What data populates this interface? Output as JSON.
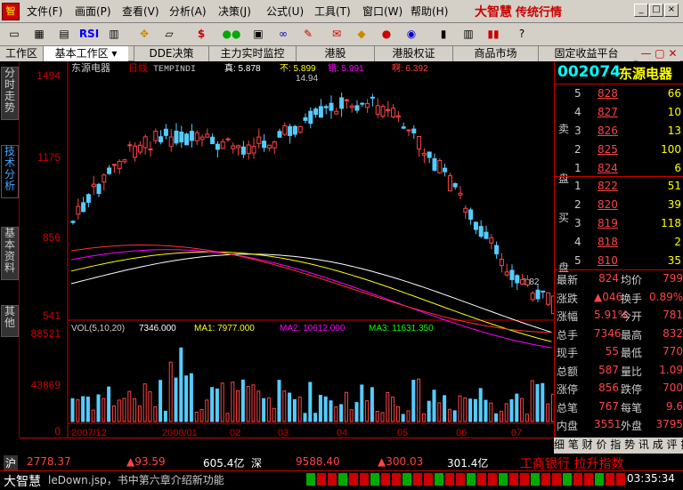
{
  "menu": {
    "items": [
      "文件(F)",
      "画面(P)",
      "查看(V)",
      "分析(A)",
      "决策(J)",
      "公式(U)",
      "工具(T)",
      "窗口(W)",
      "帮助(H)"
    ],
    "brand": "大智慧",
    "brand_sub": "传统行情",
    "app_icon": "app-icon"
  },
  "toolbar": {
    "buttons": [
      "cursor-icon",
      "kline-icon",
      "grid-icon",
      "RSI",
      "chart-icon",
      "move-icon",
      "ruler-icon",
      "$",
      "traffic-light-icon",
      "f10-icon",
      "binoculars-icon",
      "alert-icon",
      "text-icon",
      "diamond-icon",
      "ball-icon",
      "globe-icon",
      "book-icon",
      "database-icon",
      "books-icon",
      "help-icon"
    ]
  },
  "tabs": {
    "work_area": "工作区",
    "basic": "基本工作区",
    "items": [
      "DDE决策",
      "主力实时监控",
      "港股",
      "港股权证",
      "商品市场",
      "固定收益平台"
    ]
  },
  "left_tabs": [
    "分时走势",
    "技术分析",
    "基本资料",
    "其他"
  ],
  "chart": {
    "title": "东源电器",
    "period": "日线",
    "indicator": "TEMPINDI",
    "true_label": "真: 5.878",
    "non_label": "不: 5.899",
    "err_label": "错: 5.991",
    "seize_label": "啊: 6.392",
    "high_note": "14.94",
    "low_note": "6.82",
    "price_axis": [
      "1494",
      "1175",
      "856",
      "541"
    ],
    "vol_axis": [
      "88521",
      "43869",
      "0"
    ],
    "vol_title": "VOL(5,10,20)",
    "vol_val": "7346.000",
    "ma1": "MA1: 7977.000",
    "ma2": "MA2: 10612.000",
    "ma3": "MA3: 11631.350",
    "x_labels": [
      "2007/12",
      "2008/01",
      "02",
      "03",
      "04",
      "05",
      "06",
      "07"
    ],
    "period_tab": "日线"
  },
  "chart_data": {
    "type": "candlestick",
    "price_range": [
      541,
      1494
    ],
    "volume_range": [
      0,
      88521
    ]
  },
  "quote": {
    "code": "002074",
    "name": "东源电器",
    "sell_label": "卖盘",
    "buy_label": "买盘",
    "sell": [
      {
        "n": "5",
        "p": "828",
        "v": "66"
      },
      {
        "n": "4",
        "p": "827",
        "v": "10"
      },
      {
        "n": "3",
        "p": "826",
        "v": "13"
      },
      {
        "n": "2",
        "p": "825",
        "v": "100"
      },
      {
        "n": "1",
        "p": "824",
        "v": "6"
      }
    ],
    "buy": [
      {
        "n": "1",
        "p": "822",
        "v": "51"
      },
      {
        "n": "2",
        "p": "820",
        "v": "39"
      },
      {
        "n": "3",
        "p": "819",
        "v": "118"
      },
      {
        "n": "4",
        "p": "818",
        "v": "2"
      },
      {
        "n": "5",
        "p": "810",
        "v": "35"
      }
    ],
    "stats": [
      [
        "最新",
        "824",
        "均价",
        "799"
      ],
      [
        "涨跌",
        "▲046",
        "换手",
        "0.89%"
      ],
      [
        "涨幅",
        "5.91%",
        "今开",
        "781"
      ],
      [
        "总手",
        "7346",
        "最高",
        "832"
      ],
      [
        "现手",
        "55",
        "最低",
        "770"
      ],
      [
        "总额",
        "587",
        "量比",
        "1.09"
      ],
      [
        "涨停",
        "856",
        "跌停",
        "700"
      ],
      [
        "总笔",
        "767",
        "每笔",
        "9.6"
      ],
      [
        "内盘",
        "3551",
        "外盘",
        "3795"
      ]
    ],
    "bottom_tabs": "细 笔 财 价 指 势 讯 成 评 操"
  },
  "status": {
    "row1": {
      "sh": "沪",
      "sh_val": "2778.37",
      "sh_chg": "▲93.59",
      "sh_amt": "605.4亿",
      "sz": "深",
      "sz_val": "9588.40",
      "sz_chg": "▲300.03",
      "sz_amt": "301.4亿",
      "ticker": "工商银行 拉升指数"
    },
    "row2": {
      "brand": "大智慧",
      "msg": "leDown.jsp，书中第六章介绍新功能",
      "time": "03:35:34"
    }
  }
}
